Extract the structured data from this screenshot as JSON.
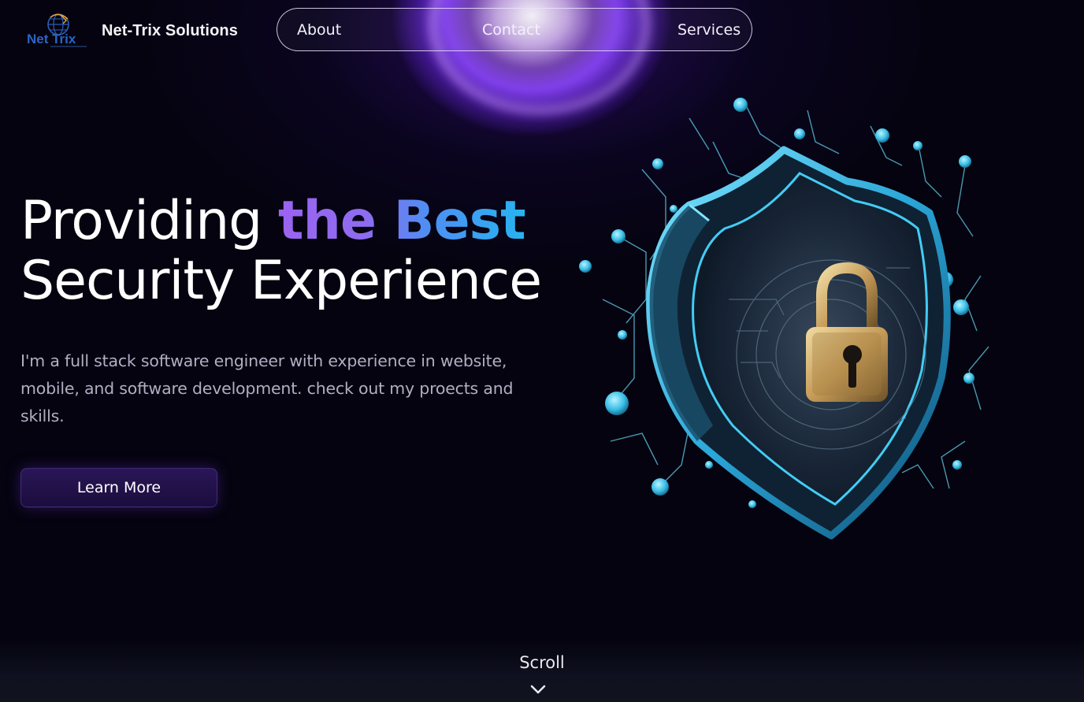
{
  "header": {
    "logo_text": "Net Trix",
    "brand": "Net-Trix Solutions"
  },
  "nav": {
    "items": [
      {
        "label": "About"
      },
      {
        "label": "Contact"
      },
      {
        "label": "Services"
      }
    ]
  },
  "hero": {
    "headline_line1_plain": "Providing ",
    "headline_line1_gradient": "the Best",
    "headline_line2": "Security Experience",
    "description": "I'm a full stack software engineer with experience in website, mobile, and software development. check out my proects and skills.",
    "cta_label": "Learn More",
    "illustration": "shield-padlock-icon"
  },
  "footer": {
    "scroll_label": "Scroll",
    "scroll_icon": "chevron-down-icon"
  },
  "colors": {
    "background": "#05030f",
    "gradient_start": "#9b63f0",
    "gradient_end": "#27b4f0",
    "accent_glow": "#8c46ff",
    "button_bg": "#2a1656",
    "shield_cyan": "#3fd0ff",
    "lock_gold": "#c9a76a"
  }
}
